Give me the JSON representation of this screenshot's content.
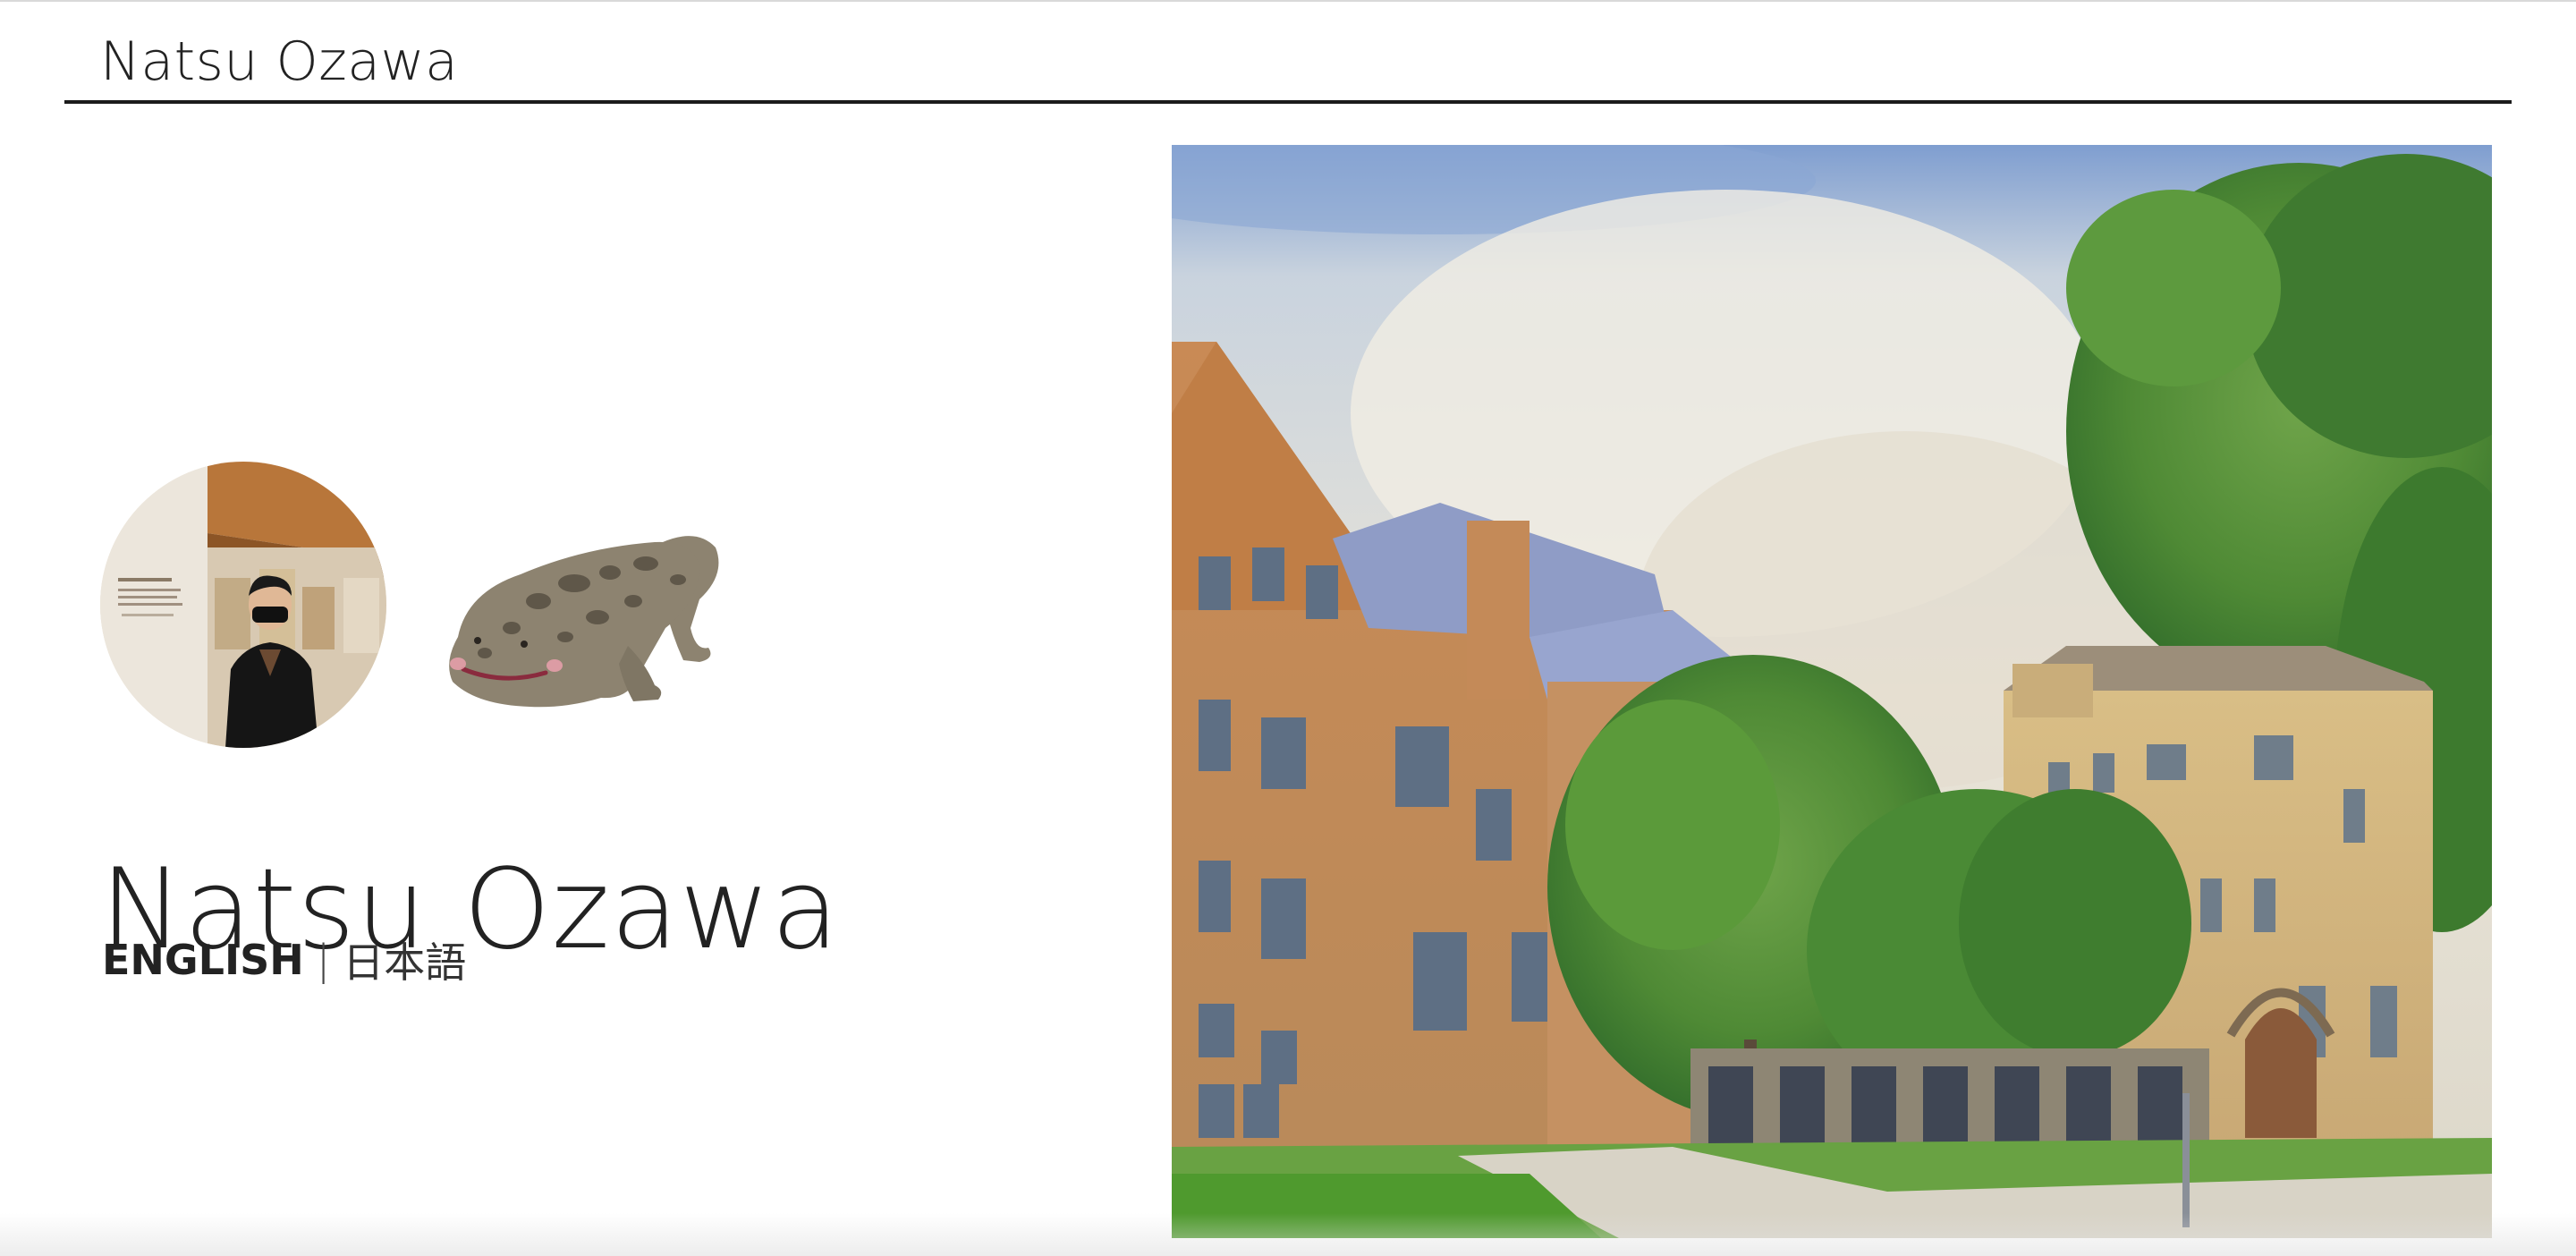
{
  "header": {
    "site_title": "Natsu Ozawa"
  },
  "hero": {
    "name": "Natsu Ozawa",
    "languages": {
      "english": "ENGLISH",
      "separator": "|",
      "japanese": "日本語"
    },
    "avatar_icon": "profile-photo",
    "mascot_icon": "giant-salamander-illustration",
    "image_icon": "campus-painting"
  },
  "colors": {
    "text": "#222222",
    "rule": "#1b1b1b",
    "background": "#ffffff"
  }
}
